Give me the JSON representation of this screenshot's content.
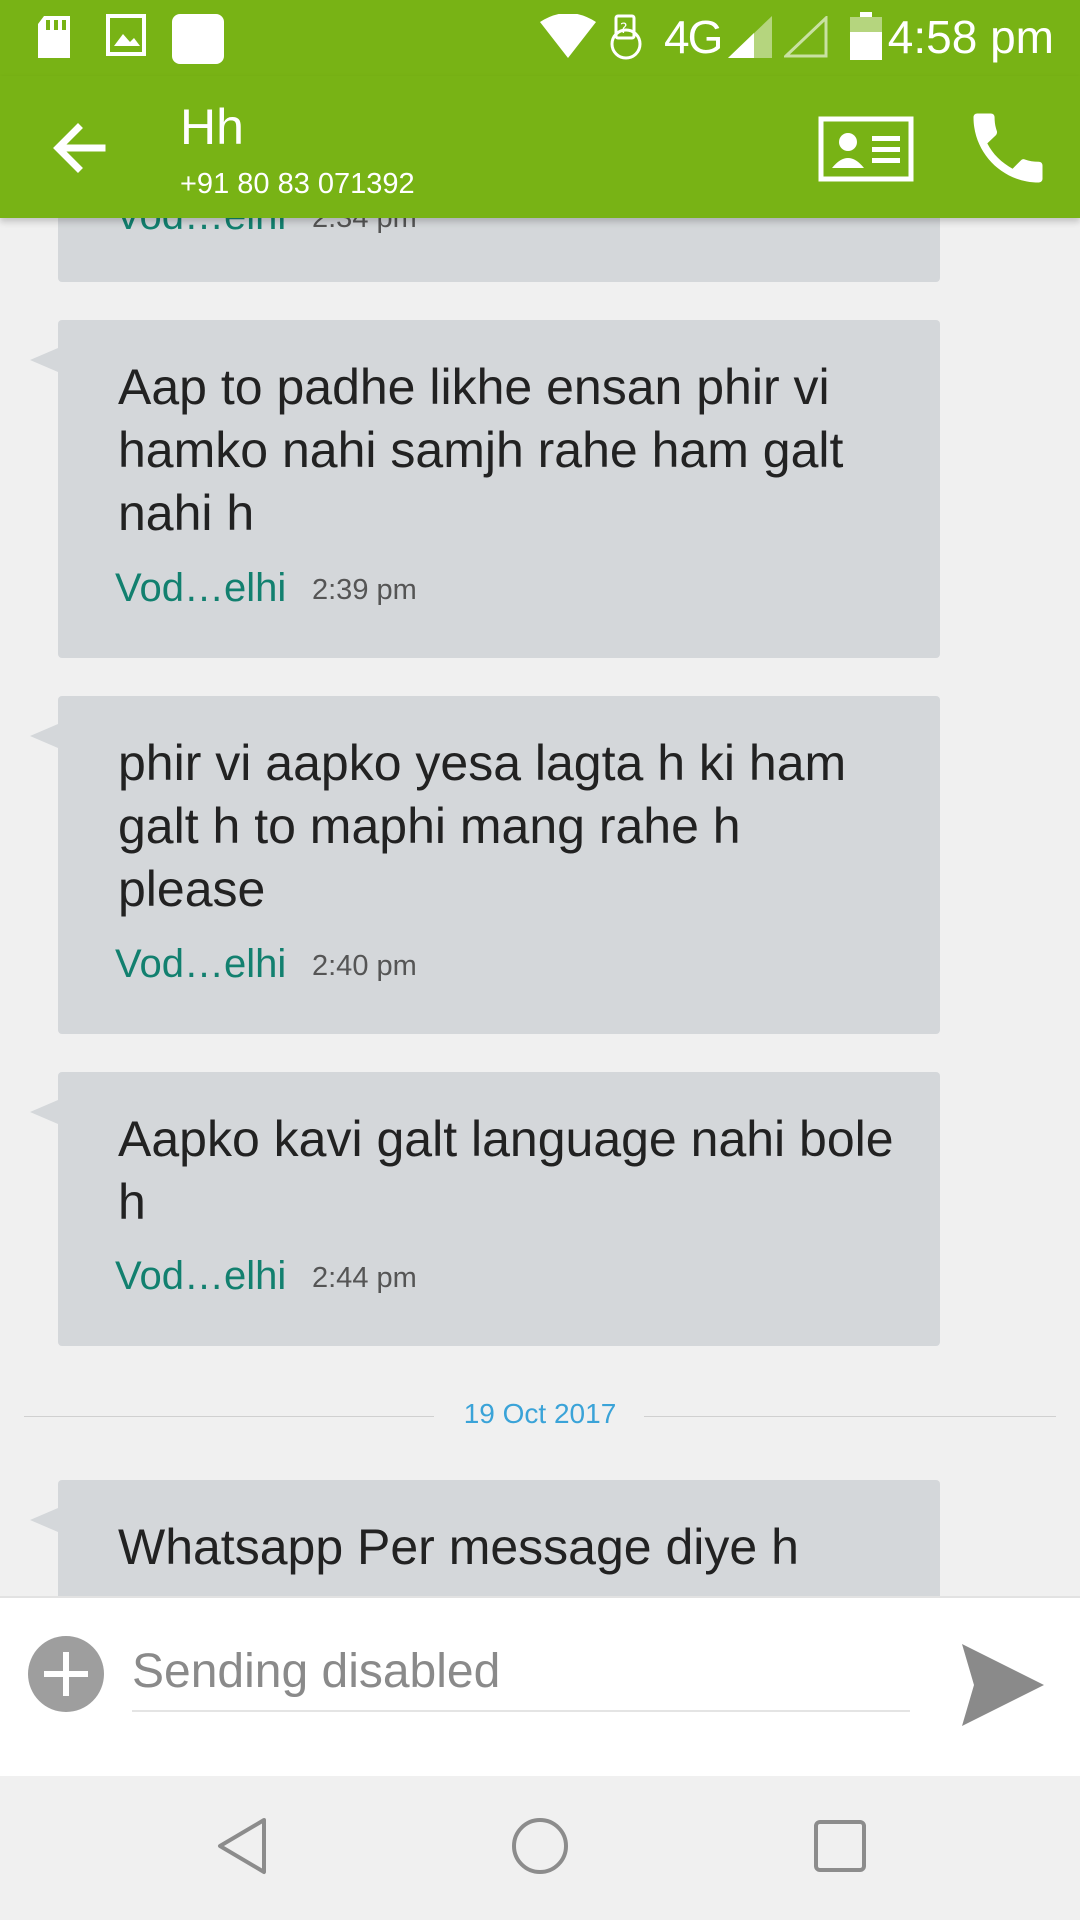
{
  "status_bar": {
    "network": "4G",
    "time": "4:58 pm",
    "icons": [
      "sd-card-icon",
      "gallery-icon",
      "app-icon",
      "wifi-icon",
      "data-transfer-icon",
      "signal-icon",
      "signal-empty-icon",
      "battery-icon"
    ]
  },
  "toolbar": {
    "contact_name": "Hh",
    "contact_number": "+91 80 83 071392",
    "back_icon": "arrow-left-icon",
    "card_icon": "contact-card-icon",
    "call_icon": "phone-icon"
  },
  "messages": [
    {
      "text": "",
      "sim": "Vod…elhi",
      "time": "2:34 pm"
    },
    {
      "text": "Aap to padhe likhe ensan phir vi hamko nahi samjh rahe ham galt nahi h",
      "sim": "Vod…elhi",
      "time": "2:39 pm"
    },
    {
      "text": "phir vi aapko yesa lagta h ki ham galt h to maphi mang rahe h please",
      "sim": "Vod…elhi",
      "time": "2:40 pm"
    },
    {
      "text": "Aapko kavi galt language nahi bole h",
      "sim": "Vod…elhi",
      "time": "2:44 pm"
    },
    {
      "text": "Whatsapp Per message diye h",
      "sim": "",
      "time": ""
    }
  ],
  "date_separator": "19 Oct 2017",
  "composer": {
    "placeholder": "Sending disabled",
    "add_icon": "plus-circle-icon",
    "send_icon": "send-icon"
  },
  "nav_bar": {
    "icons": [
      "back-triangle-icon",
      "home-circle-icon",
      "recents-square-icon"
    ]
  },
  "colors": {
    "accent": "#78b315",
    "bubble": "#d4d7da",
    "sim_label": "#12806f",
    "date_label": "#3aa3d8"
  }
}
